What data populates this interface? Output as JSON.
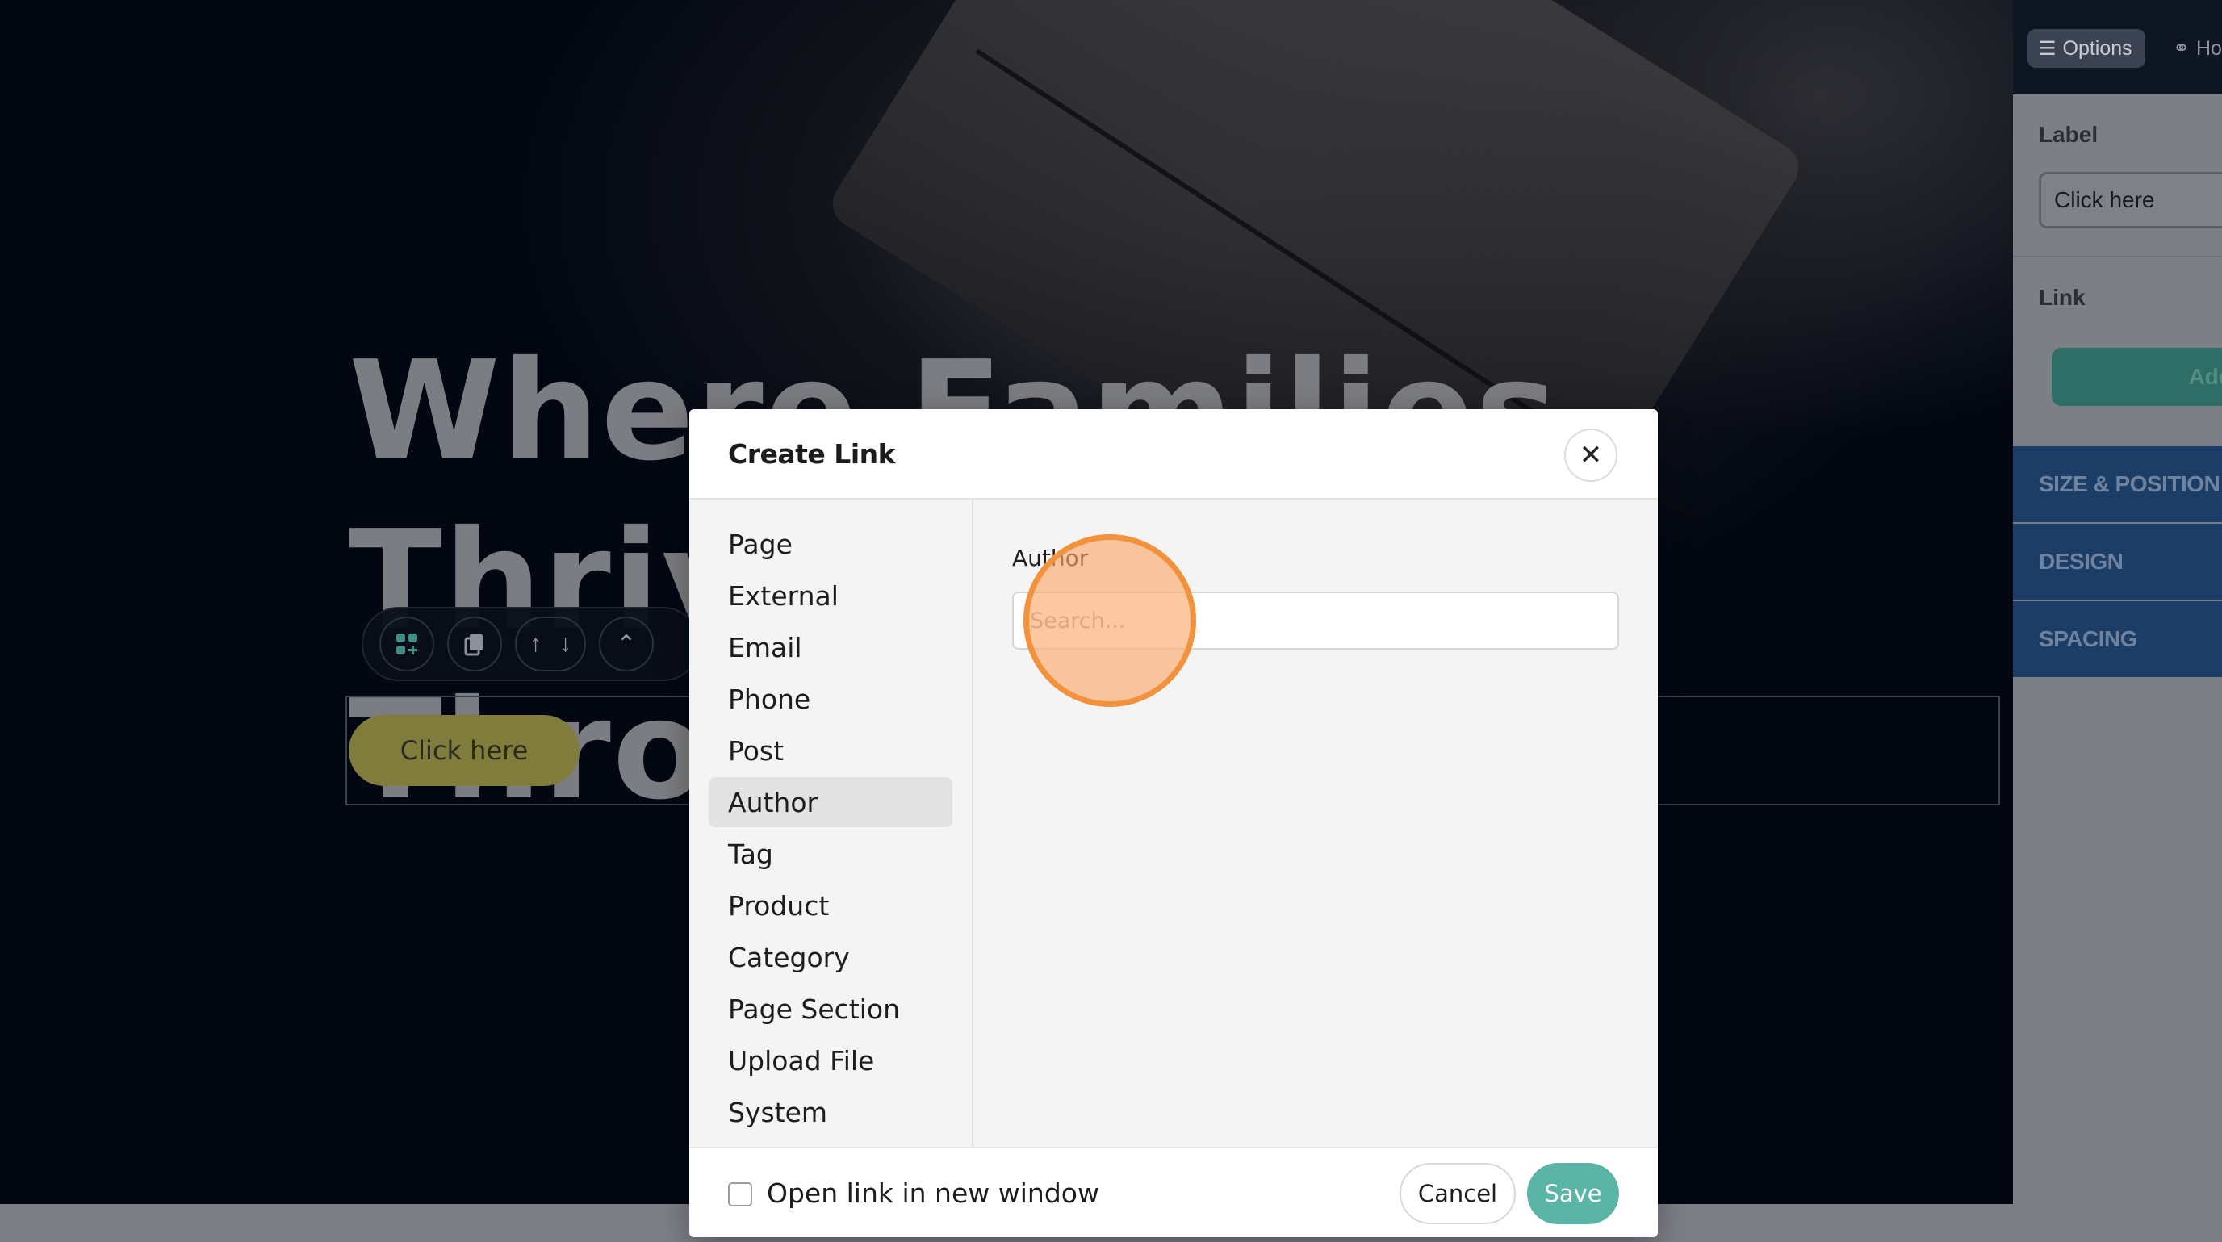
{
  "hero": {
    "title_line1": "Where Families Thrive",
    "title_line2": "Throu",
    "cta_label": "Click here"
  },
  "block_toolbar": {
    "icons": [
      "grid-add-icon",
      "copy-icon",
      "arrow-up-icon",
      "arrow-down-icon",
      "chevron-double-up-icon"
    ]
  },
  "panel": {
    "tabs": [
      {
        "label": "Options",
        "icon": "sliders-icon"
      },
      {
        "label": "Ho",
        "icon": "hover-icon"
      }
    ],
    "label_title": "Label",
    "label_value": "Click here",
    "link_title": "Link",
    "add_label": "Add",
    "sections": [
      "SIZE & POSITION",
      "DESIGN",
      "SPACING"
    ]
  },
  "modal": {
    "title": "Create Link",
    "close_icon": "close-icon",
    "sidebar_items": [
      "Page",
      "External",
      "Email",
      "Phone",
      "Post",
      "Author",
      "Tag",
      "Product",
      "Category",
      "Page Section",
      "Upload File",
      "System"
    ],
    "active_item": "Author",
    "content_label": "Author",
    "search_placeholder": "Search...",
    "open_new_window_label": "Open link in new window",
    "open_new_window_checked": false,
    "cancel_label": "Cancel",
    "save_label": "Save"
  },
  "colors": {
    "accent": "#5ab5a6",
    "cta": "#7f7c3c",
    "section_bg": "#1c3d66",
    "click_marker": "#f3923c"
  }
}
